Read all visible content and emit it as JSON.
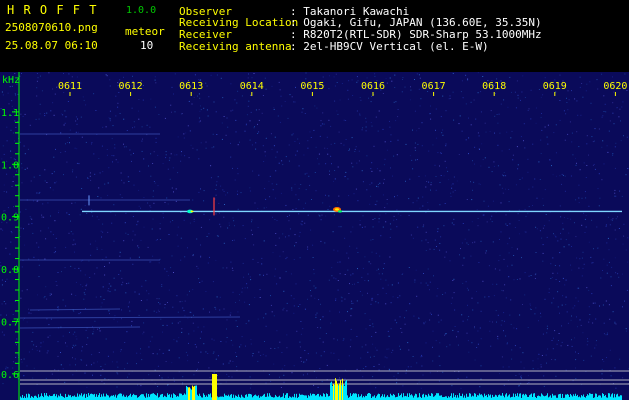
{
  "app": {
    "name": "H R O F F T",
    "version": "1.0.0"
  },
  "file": {
    "name": "2508070610.png",
    "datetime": "25.08.07 06:10"
  },
  "detection": {
    "label": "meteor",
    "count": "10"
  },
  "info": {
    "observer_label": "Observer",
    "observer_value": ": Takanori Kawachi",
    "location_label": "Receiving Location",
    "location_value": ": Ogaki, Gifu, JAPAN (136.60E, 35.35N)",
    "receiver_label": "Receiver",
    "receiver_value": ": R820T2(RTL-SDR) SDR-Sharp 53.1000MHz",
    "antenna_label": "Receiving antenna",
    "antenna_value": ": 2el-HB9CV Vertical (el. E-W)"
  },
  "spectrogram": {
    "unit_label": "kHz",
    "time_ticks": [
      "0611",
      "0612",
      "0613",
      "0614",
      "0615",
      "0616",
      "0617",
      "0618",
      "0619",
      "0620"
    ],
    "freq_ticks": [
      "1.1",
      "1.0",
      "0.9",
      "0.8",
      "0.7",
      "0.6"
    ],
    "freq_range_khz": [
      0.55,
      1.18
    ],
    "carrier_khz": 0.91,
    "colors": {
      "background": "#0a0a5a",
      "axis": "#00ff00",
      "time_label": "#ffff00",
      "carrier": "#7fd6ff",
      "activity": "#00e5ff",
      "meteor": "#ffff00",
      "reference_line": "#dcdcdc"
    }
  }
}
